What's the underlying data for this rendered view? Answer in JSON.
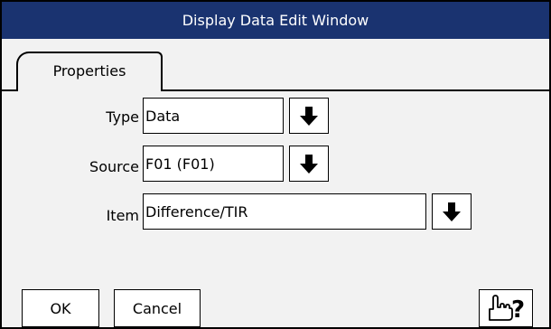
{
  "window": {
    "title": "Display Data Edit Window"
  },
  "tabs": [
    {
      "label": "Properties",
      "selected": true
    }
  ],
  "fields": {
    "type": {
      "label": "Type",
      "value": "Data"
    },
    "source": {
      "label": "Source",
      "value": "F01 (F01)"
    },
    "item": {
      "label": "Item",
      "value": "Difference/TIR"
    }
  },
  "buttons": {
    "ok": "OK",
    "cancel": "Cancel",
    "help_glyph": "?"
  },
  "icons": {
    "dropdown": "down-arrow-icon",
    "help": "pointing-hand-help-icon"
  },
  "colors": {
    "titlebar": "#1a3370",
    "background": "#f2f2f2"
  }
}
